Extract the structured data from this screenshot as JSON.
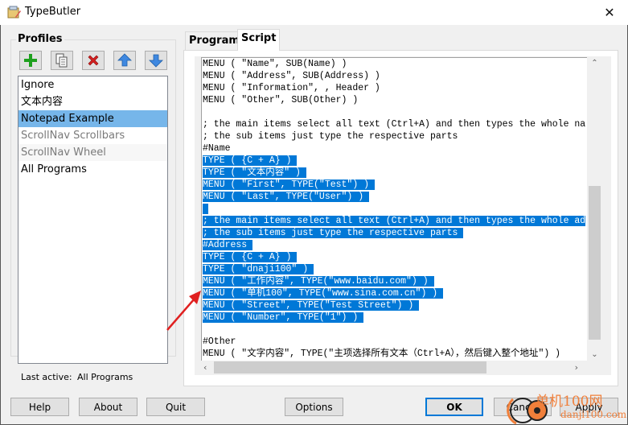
{
  "window": {
    "title": "TypeButler",
    "close_label": "✕"
  },
  "profiles": {
    "label": "Profiles",
    "toolbar": [
      {
        "name": "add-profile-button",
        "icon": "plus-icon"
      },
      {
        "name": "copy-profile-button",
        "icon": "copy-icon"
      },
      {
        "name": "delete-profile-button",
        "icon": "delete-icon"
      },
      {
        "name": "move-up-button",
        "icon": "arrow-up-icon"
      },
      {
        "name": "move-down-button",
        "icon": "arrow-down-icon"
      }
    ],
    "items": [
      {
        "label": "Ignore",
        "state": "normal"
      },
      {
        "label": "文本内容",
        "state": "normal"
      },
      {
        "label": "Notepad Example",
        "state": "selected"
      },
      {
        "label": "ScrollNav Scrollbars",
        "state": "disabled"
      },
      {
        "label": "ScrollNav Wheel",
        "state": "disabled"
      },
      {
        "label": "All Programs",
        "state": "normal"
      }
    ],
    "last_active_label": "Last active:",
    "last_active_value": "All Programs"
  },
  "tabs": [
    {
      "label": "Programs",
      "active": false
    },
    {
      "label": "Script",
      "active": true
    }
  ],
  "script": {
    "lines": [
      {
        "text": "MENU ( \"Name\", SUB(Name) )",
        "selected": false
      },
      {
        "text": "MENU ( \"Address\", SUB(Address) )",
        "selected": false
      },
      {
        "text": "MENU ( \"Information\", , Header )",
        "selected": false
      },
      {
        "text": "MENU ( \"Other\", SUB(Other) )",
        "selected": false
      },
      {
        "text": "",
        "selected": false
      },
      {
        "text": "; the main items select all text (Ctrl+A) and then types the whole na",
        "selected": false
      },
      {
        "text": "; the sub items just type the respective parts",
        "selected": false
      },
      {
        "text": "#Name",
        "selected": false
      },
      {
        "text": "TYPE ( {C + A} ) ",
        "selected": true
      },
      {
        "text": "TYPE ( \"文本内容\" ) ",
        "selected": true
      },
      {
        "text": "MENU ( \"First\", TYPE(\"Test\") ) ",
        "selected": true
      },
      {
        "text": "MENU ( \"Last\", TYPE(\"User\") ) ",
        "selected": true
      },
      {
        "text": " ",
        "selected": true
      },
      {
        "text": "; the main items select all text (Ctrl+A) and then types the whole ad",
        "selected": true
      },
      {
        "text": "; the sub items just type the respective parts ",
        "selected": true
      },
      {
        "text": "#Address ",
        "selected": true
      },
      {
        "text": "TYPE ( {C + A} ) ",
        "selected": true
      },
      {
        "text": "TYPE ( \"dnaji100\" ) ",
        "selected": true
      },
      {
        "text": "MENU ( \"工作内容\", TYPE(\"www.baidu.com\") ) ",
        "selected": true
      },
      {
        "text": "MENU ( \"单机100\", TYPE(\"www.sina.com.cn\") ) ",
        "selected": true
      },
      {
        "text": "MENU ( \"Street\", TYPE(\"Test Street\") ) ",
        "selected": true
      },
      {
        "text": "MENU ( \"Number\", TYPE(\"1\") ) ",
        "selected": true
      },
      {
        "text": "",
        "selected": false
      },
      {
        "text": "#Other",
        "selected": false
      },
      {
        "text": "MENU ( \"文字内容\", TYPE(\"主项选择所有文本（Ctrl+A），然后键入整个地址\") )",
        "selected": false
      }
    ],
    "selection_color": "#0078d7"
  },
  "buttons": {
    "help": "Help",
    "about": "About",
    "quit": "Quit",
    "options": "Options",
    "ok": "OK",
    "cancel": "Cancel",
    "apply": "Apply"
  },
  "watermark": {
    "line1": "单机100网",
    "line2": "danji100.com",
    "color": "#f07f3a"
  }
}
